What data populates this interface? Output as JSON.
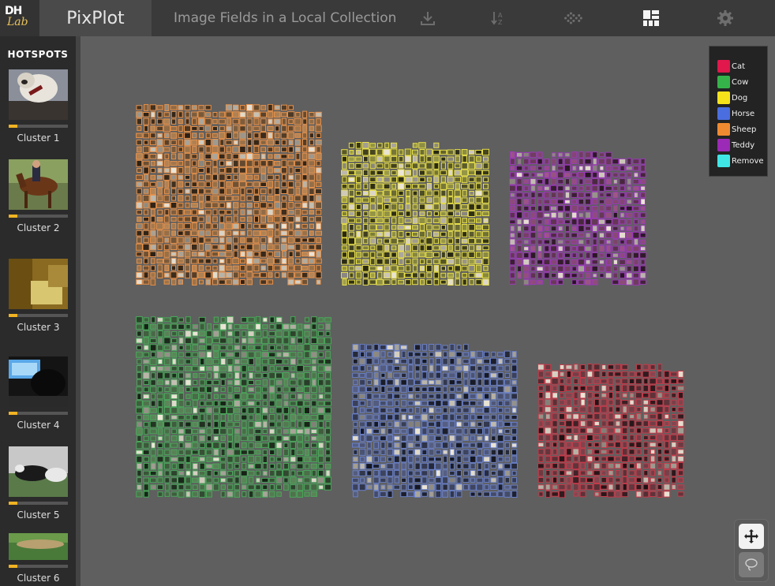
{
  "header": {
    "logo_top": "DH",
    "logo_bottom": "Lab",
    "app_title": "PixPlot",
    "collection_title": "Image Fields in a Local Collection",
    "icons": [
      "download-icon",
      "sort-alpha-icon",
      "umap-layout-icon",
      "grid-layout-icon",
      "settings-icon"
    ]
  },
  "sidebar": {
    "title": "HOTSPOTS",
    "hotspots": [
      {
        "label": "Cluster 1",
        "progress": 0.14
      },
      {
        "label": "Cluster 2",
        "progress": 0.14
      },
      {
        "label": "Cluster 3",
        "progress": 0.14
      },
      {
        "label": "Cluster 4",
        "progress": 0.14
      },
      {
        "label": "Cluster 5",
        "progress": 0.14
      },
      {
        "label": "Cluster 6",
        "progress": 0.14
      }
    ]
  },
  "legend": {
    "items": [
      {
        "label": "Cat",
        "color": "#e0184b"
      },
      {
        "label": "Cow",
        "color": "#35b34a"
      },
      {
        "label": "Dog",
        "color": "#f5e21b"
      },
      {
        "label": "Horse",
        "color": "#4a6ee0"
      },
      {
        "label": "Sheep",
        "color": "#f08a30"
      },
      {
        "label": "Teddy",
        "color": "#9b2ab6"
      },
      {
        "label": "Remove",
        "color": "#40e6e6"
      }
    ]
  },
  "clusters": [
    {
      "name": "sheep",
      "color": "#e8924a",
      "tint": "#7a5a3a"
    },
    {
      "name": "dog",
      "color": "#e8e04a",
      "tint": "#6a6a32"
    },
    {
      "name": "teddy",
      "color": "#9a3ab8",
      "tint": "#6a3a5a"
    },
    {
      "name": "cow",
      "color": "#49a85a",
      "tint": "#3e5a3c"
    },
    {
      "name": "horse",
      "color": "#6a80c8",
      "tint": "#3a4058"
    },
    {
      "name": "cat",
      "color": "#c83a4a",
      "tint": "#583036"
    }
  ],
  "tools": {
    "pan": "pan-icon",
    "lasso": "lasso-icon"
  }
}
